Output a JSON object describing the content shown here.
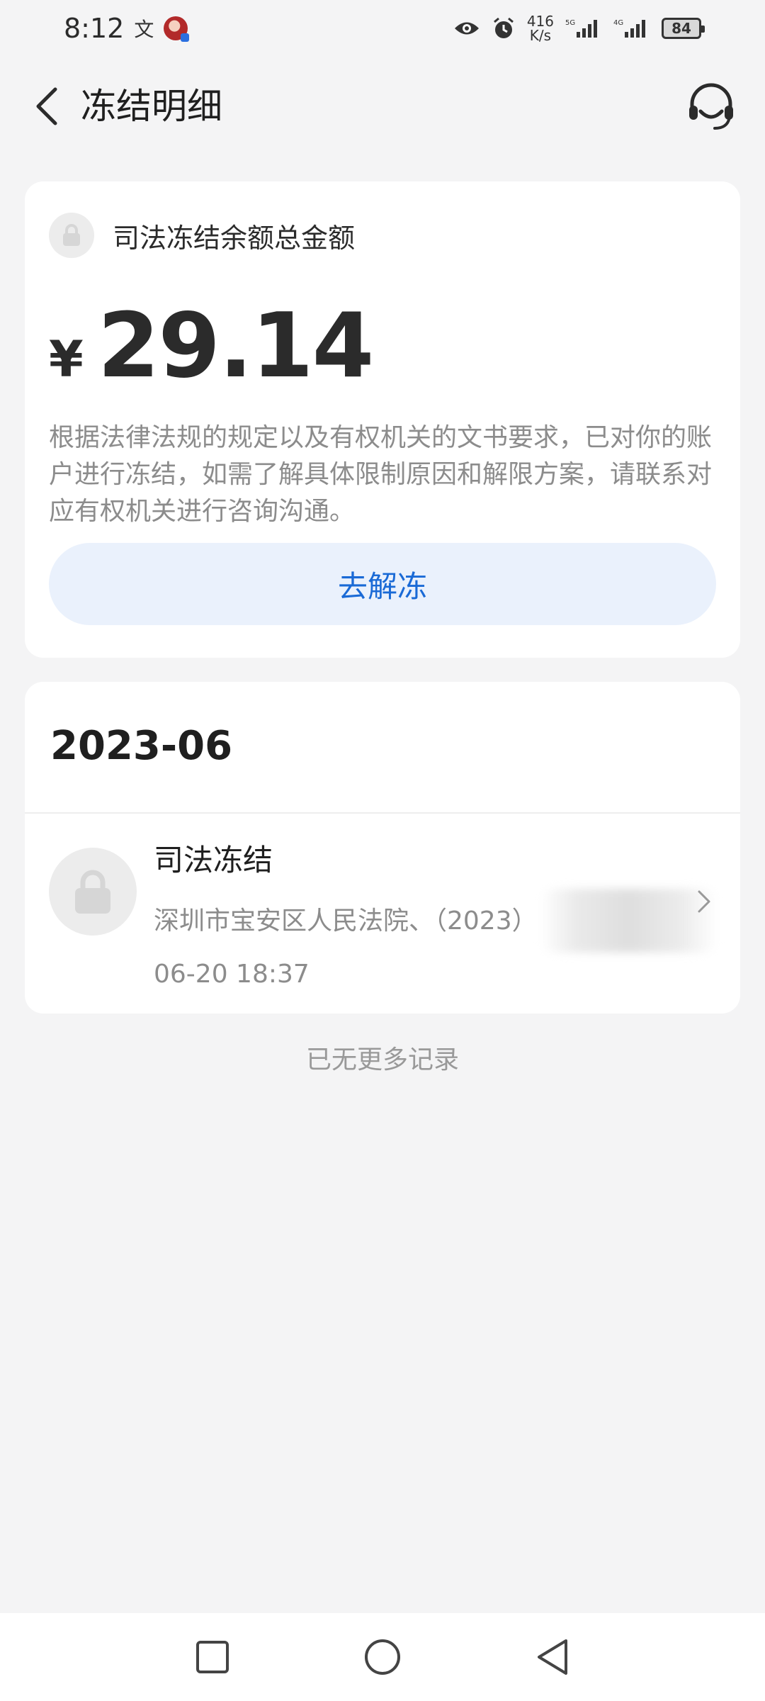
{
  "status_bar": {
    "time": "8:12",
    "speed_value": "416",
    "speed_unit": "K/s",
    "network_1": "5G",
    "network_2": "4G",
    "battery": "84",
    "icons": [
      "translate-icon",
      "avatar",
      "eye-icon",
      "alarm-icon",
      "signal-icon",
      "battery-icon"
    ]
  },
  "header": {
    "title": "冻结明细",
    "back_icon": "chevron-left-icon",
    "support_icon": "headset-icon"
  },
  "balance_card": {
    "label": "司法冻结余额总金额",
    "currency": "¥",
    "amount": "29.14",
    "notice": "根据法律法规的规定以及有权机关的文书要求，已对你的账户进行冻结，如需了解具体限制原因和解限方案，请联系对应有权机关进行咨询沟通。",
    "button_label": "去解冻",
    "accent": "#1a6ad6"
  },
  "records": {
    "month": "2023-06",
    "items": [
      {
        "title": "司法冻结",
        "description": "深圳市宝安区人民法院、（2023）",
        "time": "06-20 18:37"
      }
    ]
  },
  "footer": {
    "no_more": "已无更多记录"
  },
  "nav_bar": {
    "icons": [
      "square-icon",
      "circle-icon",
      "triangle-back-icon"
    ]
  }
}
